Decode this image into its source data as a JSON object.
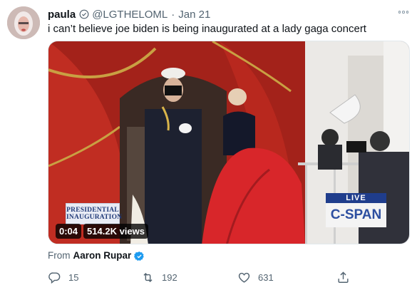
{
  "tweet": {
    "display_name": "paula",
    "handle": "@LGTHELOML",
    "separator": "·",
    "date": "Jan 21",
    "text": "i can’t believe joe biden is being inaugurated at a lady gaga concert"
  },
  "video": {
    "duration": "0:04",
    "views": "514.2K views",
    "overlay_logo": "PRESIDENTIAL INAUGURATION",
    "network_live": "LIVE",
    "network_name": "C-SPAN"
  },
  "attribution": {
    "prefix": "From",
    "author": "Aaron Rupar"
  },
  "actions": {
    "replies": "15",
    "retweets": "192",
    "likes": "631"
  },
  "colors": {
    "verified": "#1d9bf0",
    "muted": "#536471",
    "text": "#0f1419",
    "cspan_blue": "#2d4fa0"
  },
  "icons": [
    "verified-icon",
    "more-icon",
    "reply-icon",
    "retweet-icon",
    "like-icon",
    "share-icon"
  ]
}
